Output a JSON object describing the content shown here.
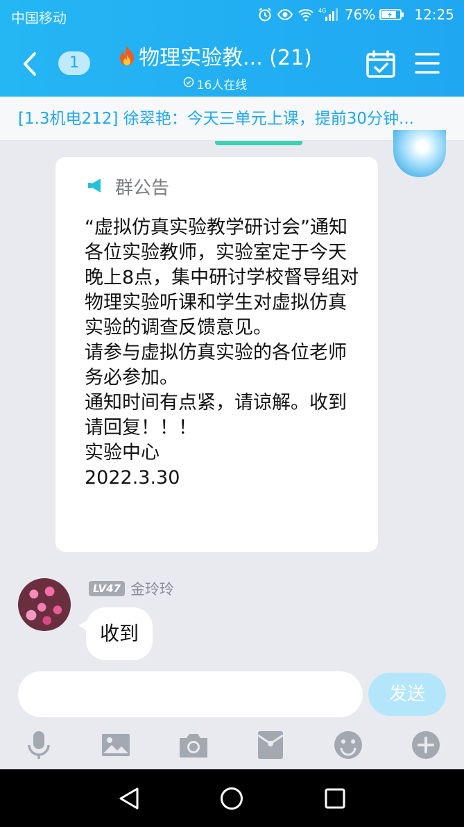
{
  "status_bar": {
    "carrier": "中国移动",
    "signal_tag": "4G",
    "battery": "76%",
    "time": "12:25"
  },
  "header": {
    "unread_count": "1",
    "group_name": "物理实验教...",
    "member_count": "(21)",
    "online": "16人在线"
  },
  "pinned_message": "[1.3机电212] 徐翠艳：今天三单元上课，提前30分钟...",
  "announcement": {
    "label": "群公告",
    "lines": [
      "“虚拟仿真实验教学研讨会”通知",
      "各位实验教师，实验室定于今天晚上8点，集中研讨学校督导组对物理实验听课和学生对虚拟仿真实验的调查反馈意见。",
      "请参与虚拟仿真实验的各位老师务必参加。",
      "通知时间有点紧，请谅解。收到请回复！！！",
      "实验中心",
      "2022.3.30"
    ]
  },
  "message": {
    "level": "LV47",
    "sender": "金玲玲",
    "text": "收到"
  },
  "composer": {
    "placeholder": "",
    "send_label": "发送"
  },
  "colors": {
    "header_blue": "#1fa8f1",
    "send_disabled": "#b3e6fb",
    "background": "#e9eaf0"
  }
}
